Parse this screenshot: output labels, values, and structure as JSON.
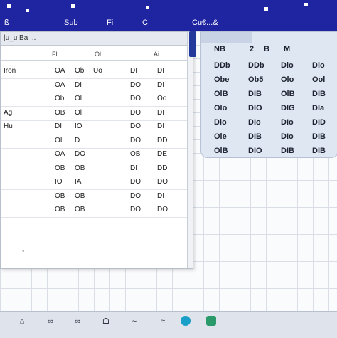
{
  "titlebar": {
    "items": [
      "ß",
      "Sub",
      "Fi",
      "C"
    ],
    "right_text": "Cu€...&"
  },
  "left_panel": {
    "top_label": "|u_u  Ba  ...",
    "header": [
      "Fl ...",
      "Ol ...",
      "Ai ..."
    ],
    "rows": [
      {
        "label": "Iron",
        "c1": "OA",
        "c2": "Ob",
        "c3": "Uo",
        "c4": "DI",
        "c5": "DI"
      },
      {
        "label": "",
        "c1": "OA",
        "c2": "DI",
        "c3": "",
        "c4": "DO",
        "c5": "DI"
      },
      {
        "label": "",
        "c1": "Ob",
        "c2": "Ol",
        "c3": "",
        "c4": "DO",
        "c5": "Oo"
      },
      {
        "label": "Ag",
        "c1": "OB",
        "c2": "Ol",
        "c3": "",
        "c4": "DO",
        "c5": "DI"
      },
      {
        "label": "Hu",
        "c1": "DI",
        "c2": "IO",
        "c3": "",
        "c4": "DO",
        "c5": "DI"
      },
      {
        "label": "",
        "c1": "OI",
        "c2": "D",
        "c3": "",
        "c4": "DO",
        "c5": "DD"
      },
      {
        "label": "",
        "c1": "OA",
        "c2": "DO",
        "c3": "",
        "c4": "OB",
        "c5": "DE"
      },
      {
        "label": "",
        "c1": "OB",
        "c2": "OB",
        "c3": "",
        "c4": "DI",
        "c5": "DD"
      },
      {
        "label": "",
        "c1": "IO",
        "c2": "IA",
        "c3": "",
        "c4": "DO",
        "c5": "DO"
      },
      {
        "label": "",
        "c1": "OB",
        "c2": "OB",
        "c3": "",
        "c4": "DO",
        "c5": "DI"
      },
      {
        "label": "",
        "c1": "OB",
        "c2": "OB",
        "c3": "",
        "c4": "DO",
        "c5": "DO"
      }
    ],
    "footer": "°"
  },
  "right_panel": {
    "header": [
      "NB",
      "2",
      "B",
      "M"
    ],
    "rows": [
      {
        "c1": "DDb",
        "c2": "DDb",
        "c3": "Dlo",
        "c4": "Dlo"
      },
      {
        "c1": "Obe",
        "c2": "Ob5",
        "c3": "Olo",
        "c4": "Ool"
      },
      {
        "c1": "OlB",
        "c2": "DIB",
        "c3": "OlB",
        "c4": "DIB"
      },
      {
        "c1": "Olo",
        "c2": "DIO",
        "c3": "DIG",
        "c4": "DIa"
      },
      {
        "c1": "Dlo",
        "c2": "DIo",
        "c3": "DIo",
        "c4": "DID"
      },
      {
        "c1": "Ole",
        "c2": "DIB",
        "c3": "DIo",
        "c4": "DIB"
      },
      {
        "c1": "OlB",
        "c2": "DIO",
        "c3": "DIB",
        "c4": "DIB"
      }
    ]
  },
  "taskbar": {
    "items": [
      "⌂",
      "∞",
      "∞",
      "ᗝ",
      "~",
      "≈"
    ]
  }
}
